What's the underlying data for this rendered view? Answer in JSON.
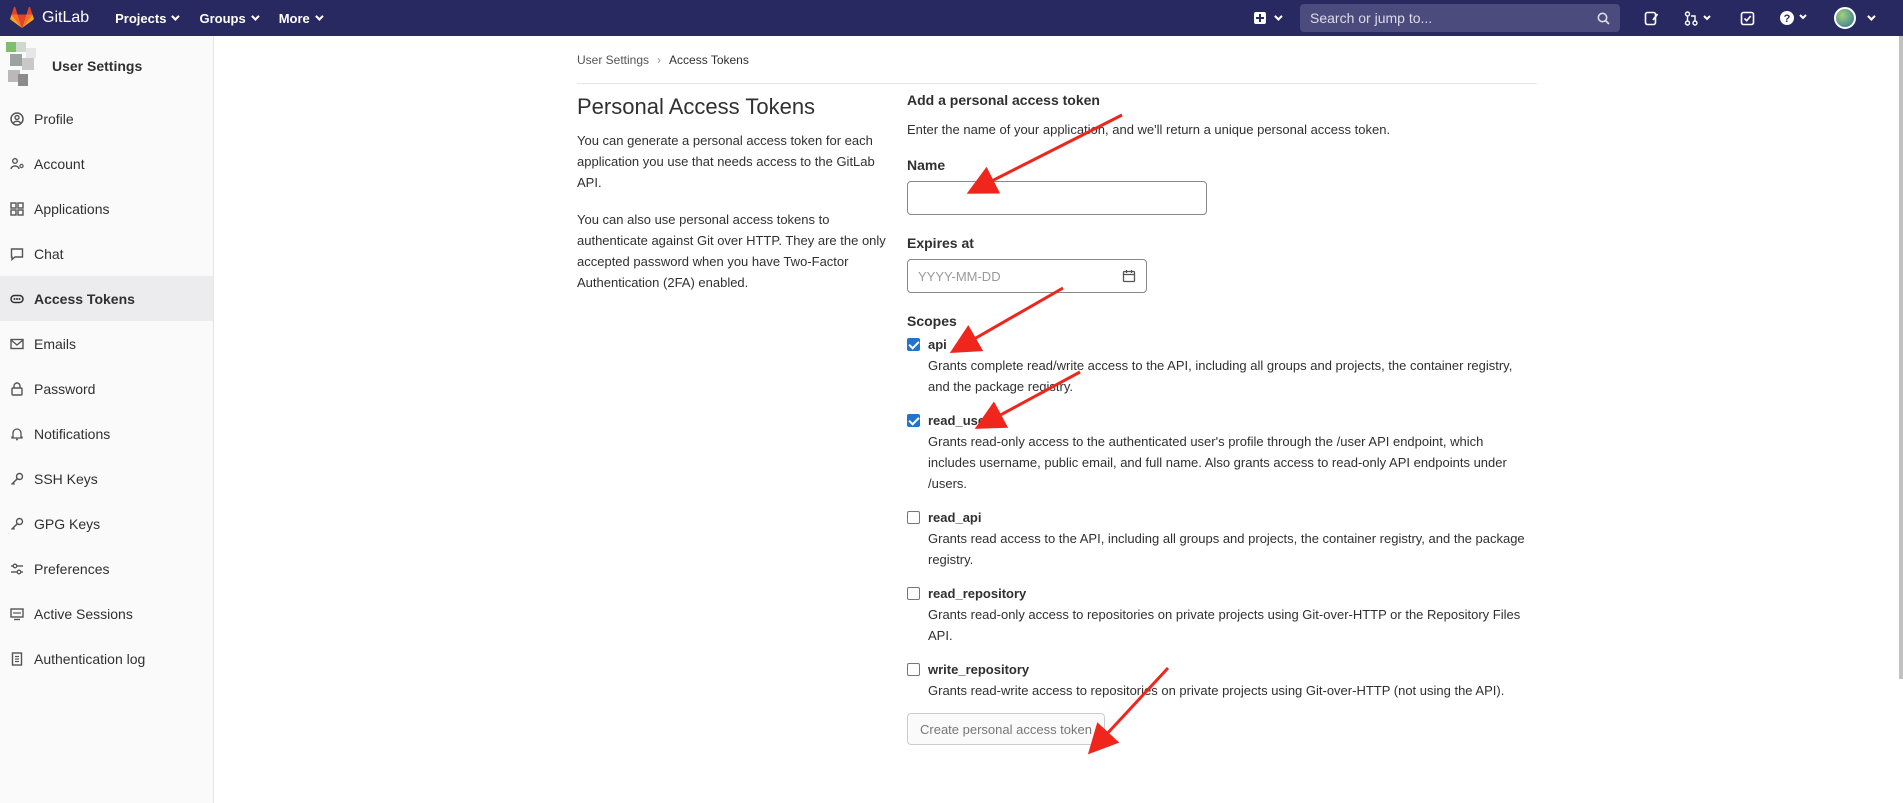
{
  "topbar": {
    "brand": "GitLab",
    "nav": [
      "Projects",
      "Groups",
      "More"
    ],
    "search_placeholder": "Search or jump to..."
  },
  "sidebar": {
    "title": "User Settings",
    "items": [
      {
        "label": "Profile",
        "icon": "profile-icon"
      },
      {
        "label": "Account",
        "icon": "account-icon"
      },
      {
        "label": "Applications",
        "icon": "applications-icon"
      },
      {
        "label": "Chat",
        "icon": "chat-icon"
      },
      {
        "label": "Access Tokens",
        "icon": "token-icon",
        "active": true
      },
      {
        "label": "Emails",
        "icon": "mail-icon"
      },
      {
        "label": "Password",
        "icon": "lock-icon"
      },
      {
        "label": "Notifications",
        "icon": "bell-icon"
      },
      {
        "label": "SSH Keys",
        "icon": "key-icon"
      },
      {
        "label": "GPG Keys",
        "icon": "key-icon"
      },
      {
        "label": "Preferences",
        "icon": "preferences-icon"
      },
      {
        "label": "Active Sessions",
        "icon": "monitor-icon"
      },
      {
        "label": "Authentication log",
        "icon": "log-icon"
      }
    ]
  },
  "breadcrumb": {
    "parent": "User Settings",
    "current": "Access Tokens"
  },
  "intro": {
    "title": "Personal Access Tokens",
    "p1": "You can generate a personal access token for each application you use that needs access to the GitLab API.",
    "p2": "You can also use personal access tokens to authenticate against Git over HTTP. They are the only accepted password when you have Two-Factor Authentication (2FA) enabled."
  },
  "form": {
    "heading": "Add a personal access token",
    "description": "Enter the name of your application, and we'll return a unique personal access token.",
    "name_label": "Name",
    "name_value": "",
    "expires_label": "Expires at",
    "expires_placeholder": "YYYY-MM-DD",
    "scopes_label": "Scopes",
    "scopes": [
      {
        "name": "api",
        "checked": true,
        "desc": "Grants complete read/write access to the API, including all groups and projects, the container registry, and the package registry."
      },
      {
        "name": "read_user",
        "checked": true,
        "desc": "Grants read-only access to the authenticated user's profile through the /user API endpoint, which includes username, public email, and full name. Also grants access to read-only API endpoints under /users."
      },
      {
        "name": "read_api",
        "checked": false,
        "desc": "Grants read access to the API, including all groups and projects, the container registry, and the package registry."
      },
      {
        "name": "read_repository",
        "checked": false,
        "desc": "Grants read-only access to repositories on private projects using Git-over-HTTP or the Repository Files API."
      },
      {
        "name": "write_repository",
        "checked": false,
        "desc": "Grants read-write access to repositories on private projects using Git-over-HTTP (not using the API)."
      }
    ],
    "submit_label": "Create personal access token"
  },
  "colors": {
    "topbar": "#292961",
    "checkbox_checked": "#1f75cb",
    "annotation_arrow": "#f0261d"
  }
}
